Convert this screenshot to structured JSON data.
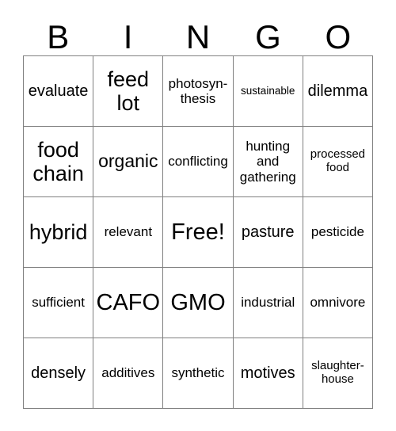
{
  "card": {
    "header_letters": [
      "B",
      "I",
      "N",
      "G",
      "O"
    ],
    "free_space_label": "Free!",
    "grid": [
      [
        {
          "text": "evaluate",
          "size": "md"
        },
        {
          "text": "feed lot",
          "size": "xl"
        },
        {
          "text": "photosyn-thesis",
          "size": "sm"
        },
        {
          "text": "sustainable",
          "size": "xxs"
        },
        {
          "text": "dilemma",
          "size": "md"
        }
      ],
      [
        {
          "text": "food chain",
          "size": "xl"
        },
        {
          "text": "organic",
          "size": "lg"
        },
        {
          "text": "conflicting",
          "size": "sm"
        },
        {
          "text": "hunting and gathering",
          "size": "sm"
        },
        {
          "text": "processed food",
          "size": "xs"
        }
      ],
      [
        {
          "text": "hybrid",
          "size": "xl"
        },
        {
          "text": "relevant",
          "size": "sm"
        },
        {
          "text": "Free!",
          "size": "xxl"
        },
        {
          "text": "pasture",
          "size": "md"
        },
        {
          "text": "pesticide",
          "size": "sm"
        }
      ],
      [
        {
          "text": "sufficient",
          "size": "sm"
        },
        {
          "text": "CAFO",
          "size": "xxl"
        },
        {
          "text": "GMO",
          "size": "xxl"
        },
        {
          "text": "industrial",
          "size": "sm"
        },
        {
          "text": "omnivore",
          "size": "sm"
        }
      ],
      [
        {
          "text": "densely",
          "size": "md"
        },
        {
          "text": "additives",
          "size": "sm"
        },
        {
          "text": "synthetic",
          "size": "sm"
        },
        {
          "text": "motives",
          "size": "md"
        },
        {
          "text": "slaughter-house",
          "size": "xs"
        }
      ]
    ]
  },
  "colors": {
    "grid_line": "#808080",
    "text": "#000000",
    "background": "#ffffff"
  }
}
